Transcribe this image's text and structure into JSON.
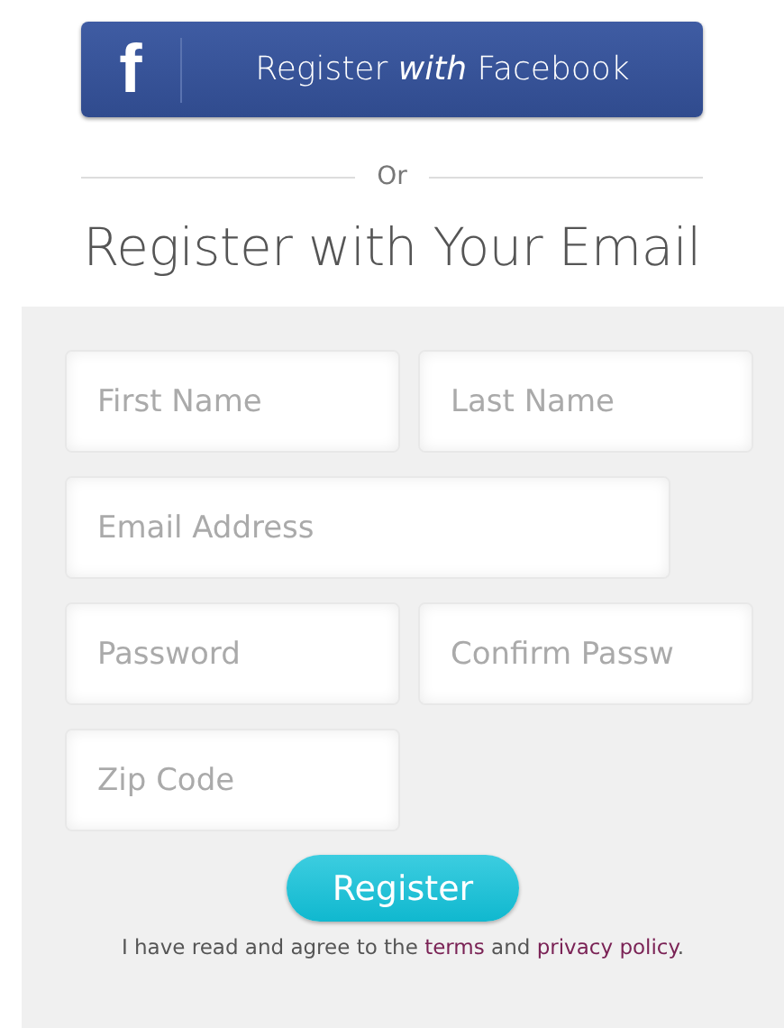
{
  "facebook_button": {
    "logo": "f",
    "label": "Register *with* Facebook"
  },
  "divider": {
    "label": "Or"
  },
  "heading": "Register with Your Email",
  "form": {
    "rows": [
      [
        {
          "kind": "short",
          "placeholder": "First Name"
        },
        {
          "kind": "short",
          "placeholder": "Last Name"
        }
      ],
      [
        {
          "kind": "wide",
          "placeholder": "Email Address"
        }
      ],
      [
        {
          "kind": "short",
          "placeholder": "Password"
        },
        {
          "kind": "short",
          "placeholder": "Confirm Passw"
        }
      ],
      [
        {
          "kind": "short",
          "placeholder": "Zip Code"
        }
      ]
    ],
    "submit": "Register",
    "agreement": {
      "before": "I have read and agree to the",
      "link1": "terms",
      "middle": "and",
      "link2": "privacy policy",
      "after": "."
    }
  }
}
